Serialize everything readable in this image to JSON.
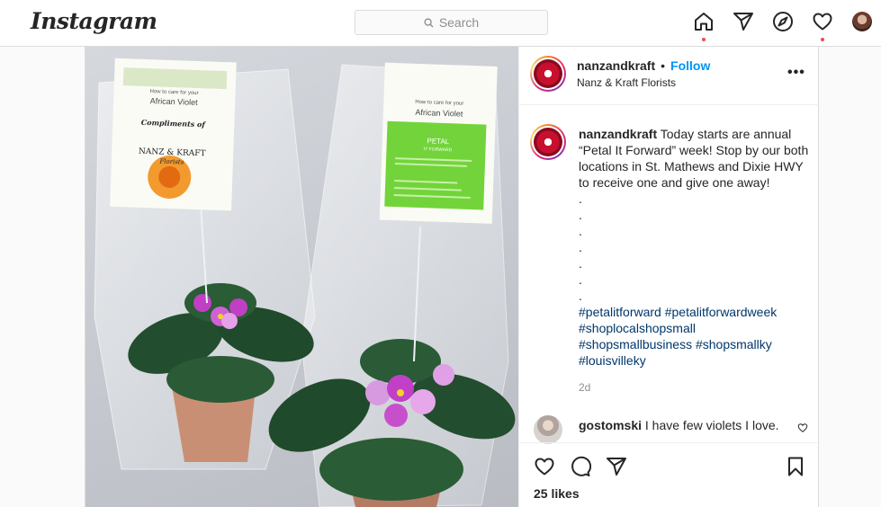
{
  "topbar": {
    "logo": "Instagram",
    "search_placeholder": "Search"
  },
  "post": {
    "account": {
      "username": "nanzandkraft",
      "separator": "•",
      "follow_label": "Follow",
      "subtitle": "Nanz & Kraft Florists",
      "more_label": "•••"
    },
    "photo": {
      "tag_left_line1": "How to care for your",
      "tag_left_line2": "African Violet",
      "tag_left_line3": "Compliments of",
      "tag_left_line4": "NANZ & KRAFT",
      "tag_left_line5": "Florists",
      "tag_right_line1": "How to care for your",
      "tag_right_line2": "African Violet",
      "tag_right_line3": "PETAL",
      "tag_right_line4": "IT FORWARD"
    },
    "caption": {
      "username": "nanzandkraft",
      "text": " Today starts are annual “Petal It Forward” week! Stop by our both locations in St. Mathews and Dixie HWY to receive one and give one away!\n.\n.\n.\n.\n.\n.\n.",
      "hashtags": "#petalitforward #petalitforwardweek #shoplocalshopsmall #shopsmallbusiness #shopsmallky #louisvilleky"
    },
    "time": "2d",
    "comment": {
      "username": "gostomski",
      "text": " I have few violets I love."
    },
    "likes": "25 likes"
  }
}
